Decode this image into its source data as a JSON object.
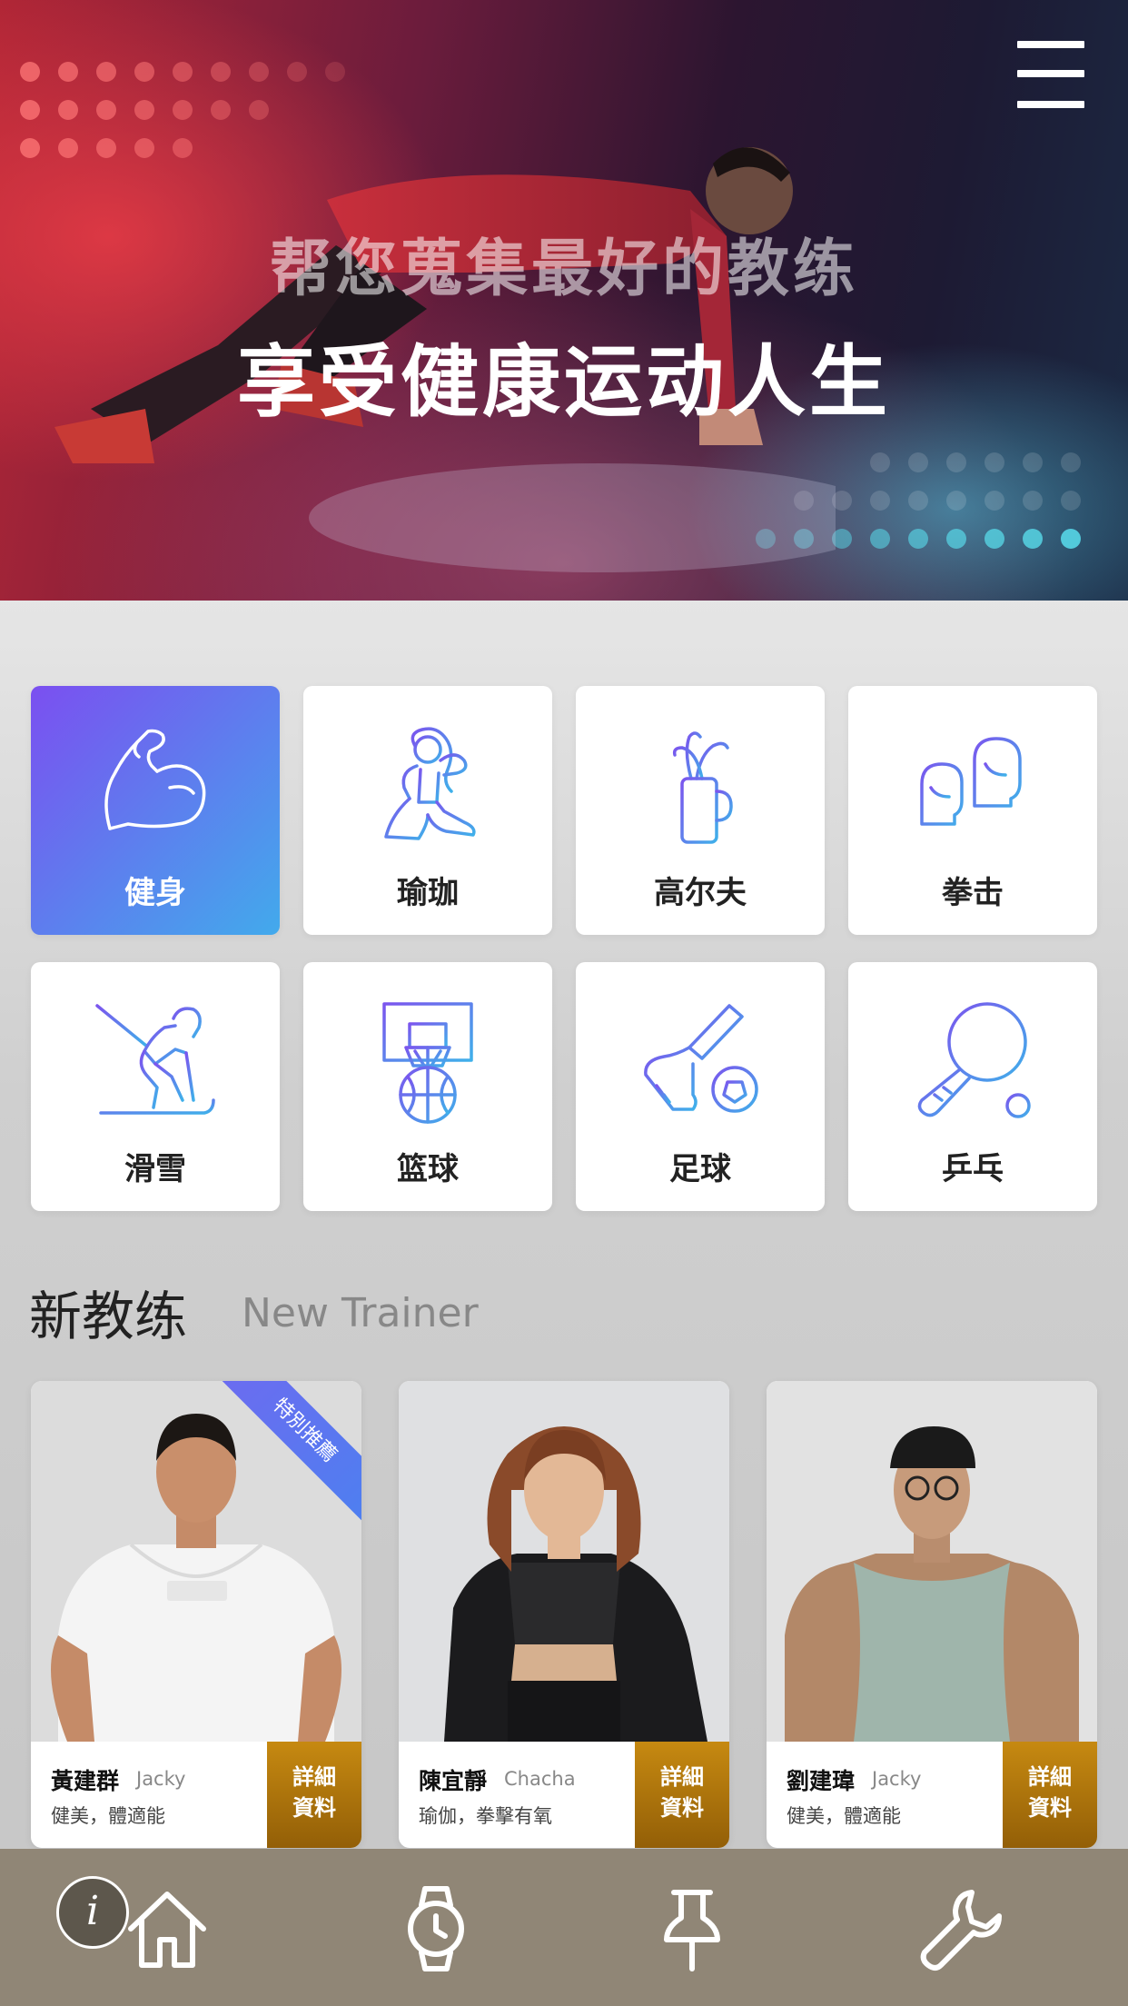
{
  "hero": {
    "subtitle": "帮您蒐集最好的教练",
    "title": "享受健康运动人生",
    "menu_icon": "hamburger-menu-icon"
  },
  "categories": [
    {
      "label": "健身",
      "icon": "flexed-arm-icon",
      "selected": true
    },
    {
      "label": "瑜珈",
      "icon": "yoga-pose-icon",
      "selected": false
    },
    {
      "label": "高尔夫",
      "icon": "golf-bag-icon",
      "selected": false
    },
    {
      "label": "拳击",
      "icon": "boxing-gloves-icon",
      "selected": false
    },
    {
      "label": "滑雪",
      "icon": "skier-icon",
      "selected": false
    },
    {
      "label": "篮球",
      "icon": "basketball-hoop-icon",
      "selected": false
    },
    {
      "label": "足球",
      "icon": "soccer-kick-icon",
      "selected": false
    },
    {
      "label": "乒乓",
      "icon": "ping-pong-paddle-icon",
      "selected": false
    }
  ],
  "new_trainer": {
    "title": "新教练",
    "subtitle": "New Trainer",
    "trainers": [
      {
        "name": "黃建群",
        "english_name": "Jacky",
        "tags": "健美，體適能",
        "detail_line1": "詳細",
        "detail_line2": "資料",
        "ribbon": "特別推薦"
      },
      {
        "name": "陳宜靜",
        "english_name": "Chacha",
        "tags": "瑜伽，拳擊有氧",
        "detail_line1": "詳細",
        "detail_line2": "資料"
      },
      {
        "name": "劉建瑋",
        "english_name": "Jacky",
        "tags": "健美，體適能",
        "detail_line1": "詳細",
        "detail_line2": "資料"
      }
    ]
  },
  "bottom_nav": {
    "info_label": "i",
    "items": [
      {
        "icon": "home-icon"
      },
      {
        "icon": "smartwatch-icon"
      },
      {
        "icon": "pin-icon"
      },
      {
        "icon": "wrench-icon"
      }
    ]
  },
  "colors": {
    "accent_gradient_start": "#7b4ff0",
    "accent_gradient_end": "#42aaec",
    "detail_button": "#b37a0d",
    "bottom_nav_bg": "#908676"
  }
}
